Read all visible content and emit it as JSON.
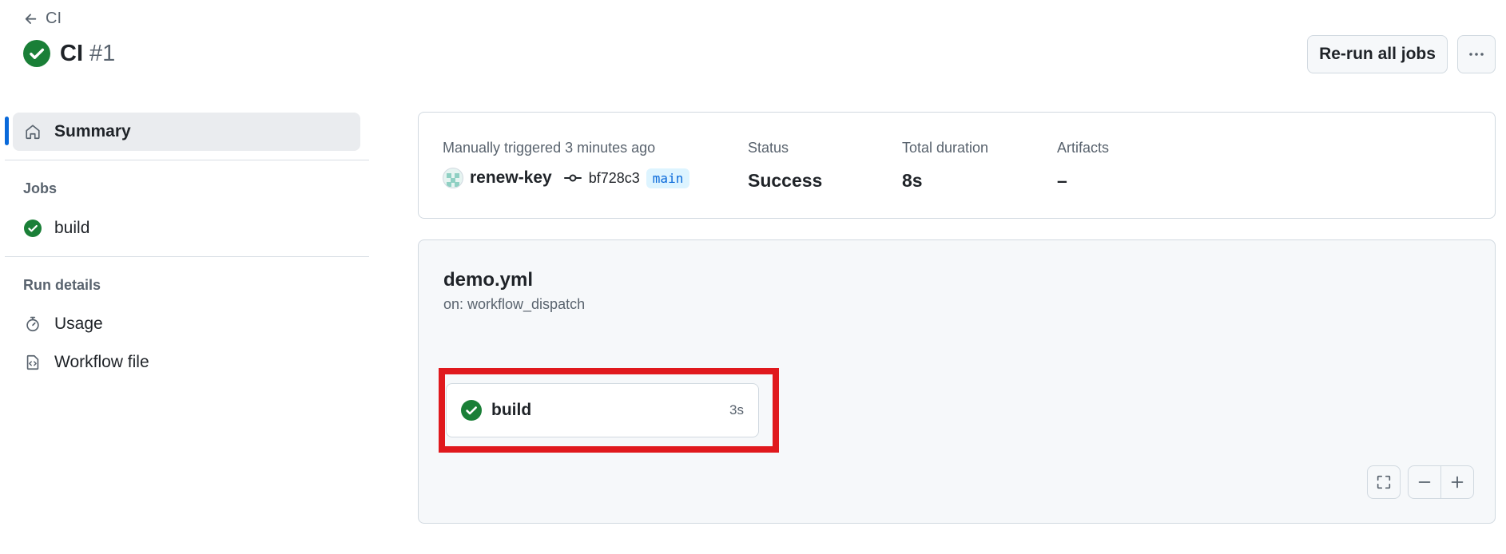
{
  "header": {
    "back_label": "CI",
    "workflow_title": "CI",
    "run_number": "#1",
    "rerun_label": "Re-run all jobs"
  },
  "sidebar": {
    "summary_label": "Summary",
    "jobs_heading": "Jobs",
    "jobs": [
      {
        "label": "build"
      }
    ],
    "run_details_heading": "Run details",
    "usage_label": "Usage",
    "workflow_file_label": "Workflow file"
  },
  "summary": {
    "trigger_text": "Manually triggered 3 minutes ago",
    "actor": "renew-key",
    "commit_sha": "bf728c3",
    "branch": "main",
    "status_label": "Status",
    "status_value": "Success",
    "duration_label": "Total duration",
    "duration_value": "8s",
    "artifacts_label": "Artifacts",
    "artifacts_value": "–"
  },
  "graph": {
    "workflow_name": "demo.yml",
    "trigger": "on: workflow_dispatch",
    "jobs": [
      {
        "name": "build",
        "duration": "3s",
        "status": "success"
      }
    ]
  },
  "colors": {
    "success": "#1a7f37",
    "accent": "#0969da",
    "highlight": "#e0191d"
  }
}
